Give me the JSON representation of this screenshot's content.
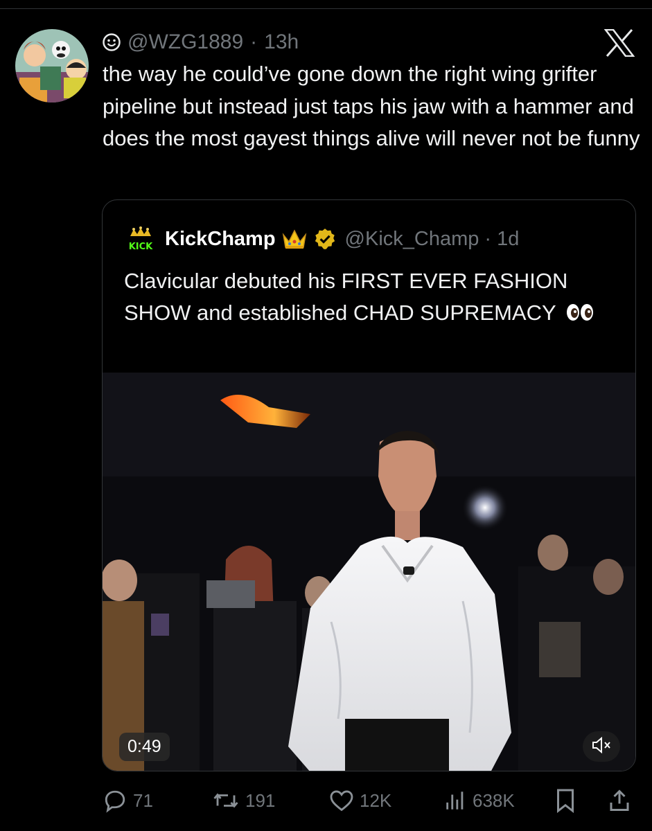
{
  "tweet": {
    "handle": "@WZG1889",
    "time": "13h",
    "text": "the way he could’ve gone down the right wing grifter pipeline but instead just taps his jaw with a hammer and does the most gayest things alive will never not be funny"
  },
  "quote": {
    "logo_text": "KICK",
    "name": "KickChamp",
    "handle": "@Kick_Champ",
    "time": "1d",
    "text": "Clavicular debuted his FIRST EVER FASHION SHOW and established CHAD SUPREMACY",
    "video_duration": "0:49"
  },
  "actions": {
    "replies": "71",
    "reposts": "191",
    "likes": "12K",
    "views": "638K"
  },
  "icons": [
    "smiley-icon",
    "x-logo-icon",
    "crown-icon",
    "verified-icon",
    "eyes-icon",
    "mute-icon",
    "reply-icon",
    "repost-icon",
    "like-icon",
    "views-icon",
    "bookmark-icon",
    "share-icon"
  ],
  "colors": {
    "background": "#000000",
    "text": "#e7e9ea",
    "secondary": "#71767b",
    "verified": "#e2b719",
    "kick_green": "#53fc18"
  }
}
